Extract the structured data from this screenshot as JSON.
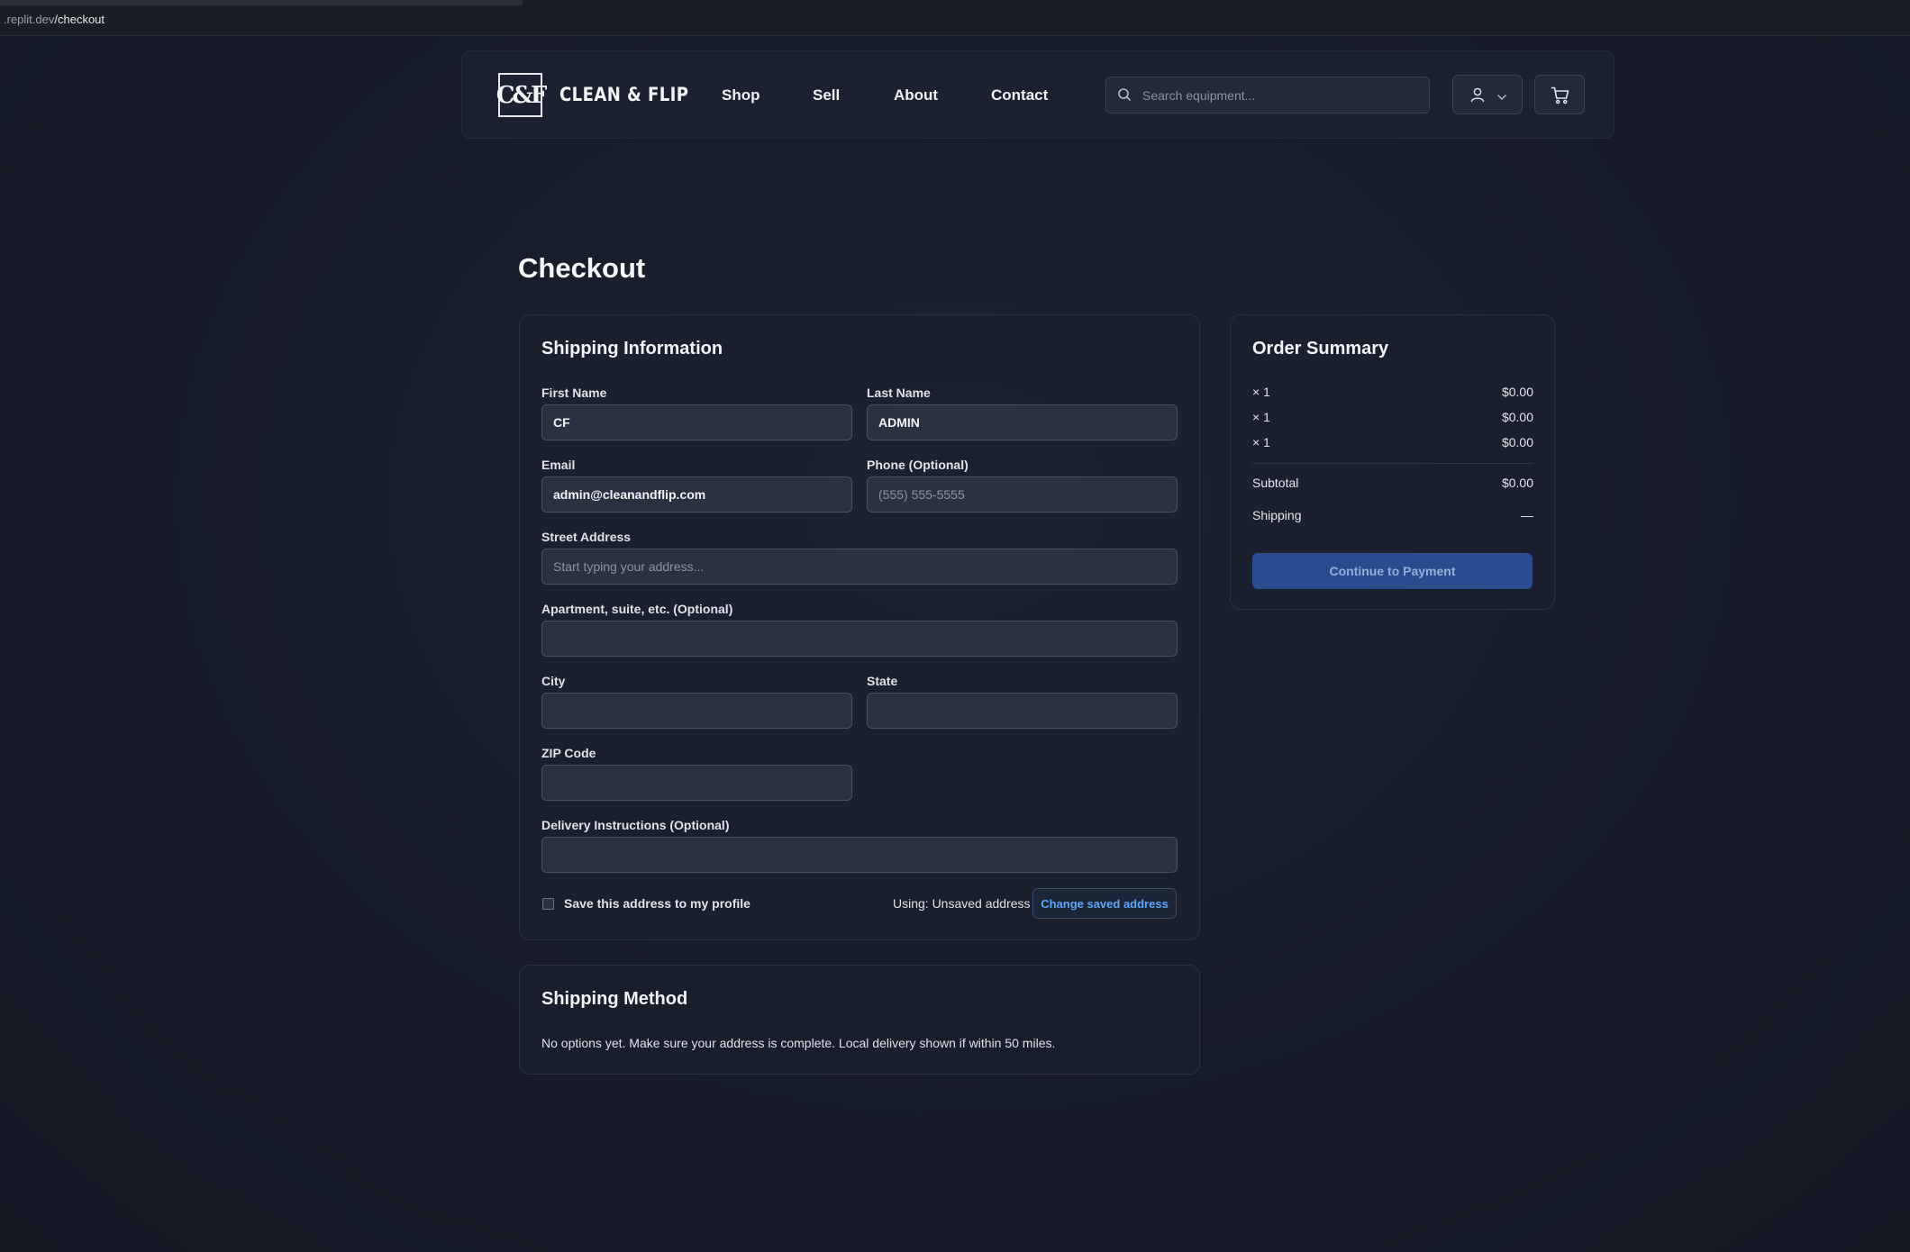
{
  "browser": {
    "url_prefix": ".replit.dev",
    "url_path": "/checkout"
  },
  "nav": {
    "logo_mark": "C&F",
    "brand": "CLEAN & FLIP",
    "links": [
      "Shop",
      "Sell",
      "About",
      "Contact"
    ],
    "search_placeholder": "Search equipment..."
  },
  "page": {
    "title": "Checkout"
  },
  "shipping": {
    "title": "Shipping Information",
    "first_name": {
      "label": "First Name",
      "value": "CF"
    },
    "last_name": {
      "label": "Last Name",
      "value": "ADMIN"
    },
    "email": {
      "label": "Email",
      "value": "admin@cleanandflip.com"
    },
    "phone": {
      "label": "Phone (Optional)",
      "placeholder": "(555) 555-5555"
    },
    "street": {
      "label": "Street Address",
      "placeholder": "Start typing your address..."
    },
    "apartment": {
      "label": "Apartment, suite, etc. (Optional)"
    },
    "city": {
      "label": "City"
    },
    "state": {
      "label": "State"
    },
    "zip": {
      "label": "ZIP Code"
    },
    "delivery": {
      "label": "Delivery Instructions (Optional)"
    },
    "save_label": "Save this address to my profile",
    "using_label": "Using: Unsaved address",
    "change_button": "Change saved address"
  },
  "shipping_method": {
    "title": "Shipping Method",
    "message": "No options yet. Make sure your address is complete. Local delivery shown if within 50 miles."
  },
  "summary": {
    "title": "Order Summary",
    "items": [
      {
        "qty": "× 1",
        "price": "$0.00"
      },
      {
        "qty": "× 1",
        "price": "$0.00"
      },
      {
        "qty": "× 1",
        "price": "$0.00"
      }
    ],
    "subtotal_label": "Subtotal",
    "subtotal_value": "$0.00",
    "shipping_label": "Shipping",
    "shipping_value": "—",
    "pay_button": "Continue to Payment"
  }
}
